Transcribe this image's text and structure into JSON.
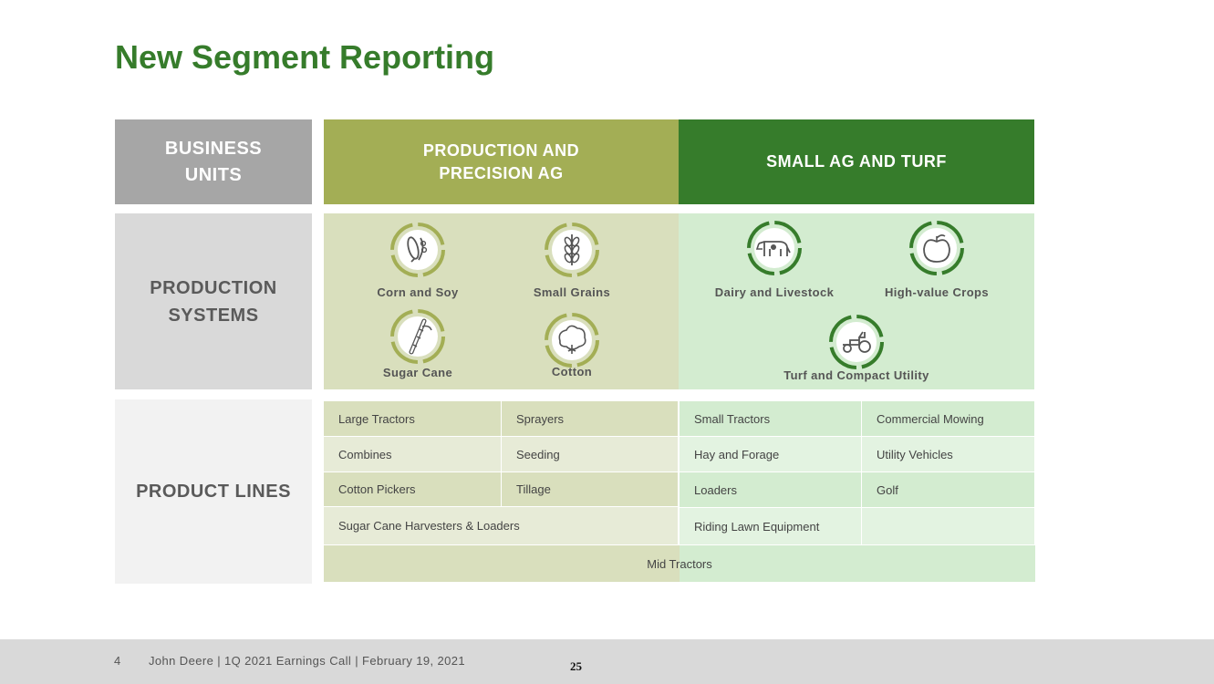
{
  "title": "New Segment Reporting",
  "headers": {
    "business_units": [
      "BUSINESS",
      "UNITS"
    ],
    "ppa": [
      "PRODUCTION AND",
      "PRECISION AG"
    ],
    "sat": "SMALL AG AND TURF"
  },
  "production_systems": {
    "label": [
      "PRODUCTION",
      "SYSTEMS"
    ],
    "ppa": [
      {
        "name": "Corn and Soy",
        "icon": "corn-soy-icon"
      },
      {
        "name": "Small Grains",
        "icon": "wheat-icon"
      },
      {
        "name": "Sugar Cane",
        "icon": "sugar-cane-icon"
      },
      {
        "name": "Cotton",
        "icon": "cotton-icon"
      }
    ],
    "sat": [
      {
        "name": "Dairy and Livestock",
        "icon": "cow-icon"
      },
      {
        "name": "High-value Crops",
        "icon": "apple-icon"
      },
      {
        "name": "Turf and Compact Utility",
        "icon": "tractor-icon"
      }
    ]
  },
  "product_lines": {
    "label": "PRODUCT LINES",
    "ppa_rows": [
      [
        "Large Tractors",
        "Sprayers"
      ],
      [
        "Combines",
        "Seeding"
      ],
      [
        "Cotton Pickers",
        "Tillage"
      ]
    ],
    "ppa_wide": "Sugar Cane Harvesters & Loaders",
    "sat_rows": [
      [
        "Small Tractors",
        "Commercial Mowing"
      ],
      [
        "Hay and Forage",
        "Utility Vehicles"
      ],
      [
        "Loaders",
        "Golf"
      ],
      [
        "Riding Lawn Equipment",
        ""
      ]
    ],
    "shared": "Mid Tractors"
  },
  "footer": {
    "number": "4",
    "text": "John Deere | 1Q 2021 Earnings Call | February 19, 2021",
    "page": "25"
  },
  "colors": {
    "brand_green": "#367c2b",
    "olive": "#a3ae55",
    "gray_header": "#a6a6a6"
  }
}
